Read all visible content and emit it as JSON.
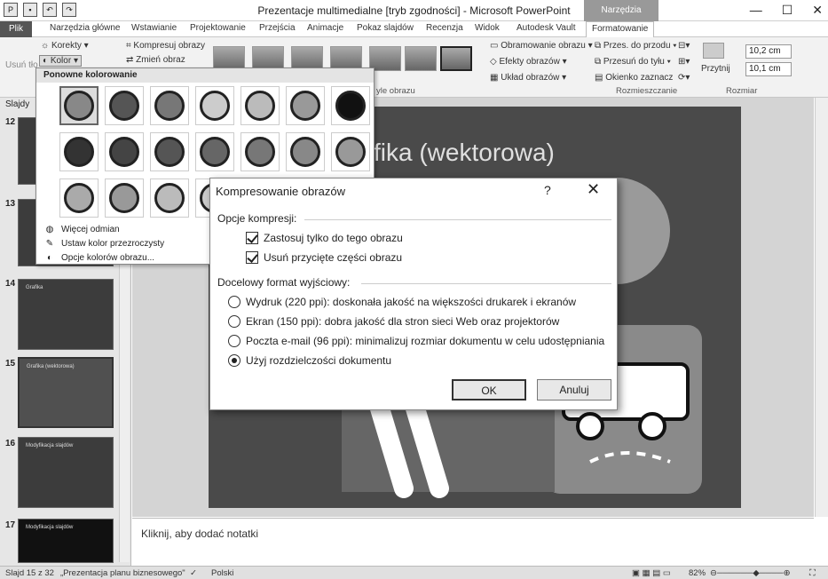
{
  "app": {
    "title": "Prezentacje multimedialne [tryb zgodności] - Microsoft PowerPoint",
    "context_tab_group": "Narzędzia obrazów",
    "window_buttons": [
      "—",
      "☐",
      "✕"
    ]
  },
  "tabs": {
    "file": "Plik",
    "items": [
      "Narzędzia główne",
      "Wstawianie",
      "Projektowanie",
      "Przejścia",
      "Animacje",
      "Pokaz slajdów",
      "Recenzja",
      "Widok",
      "Autodesk Vault"
    ],
    "active": "Formatowanie"
  },
  "ribbon": {
    "remove_bg": "Usuń tło",
    "corrections": "Korekty",
    "color": "Kolor",
    "compress": "Kompresuj obrazy",
    "change": "Zmień obraz",
    "picture_styles_label": "yle obrazu",
    "border": "Obramowanie obrazu",
    "effects": "Efekty obrazów",
    "layout": "Układ obrazów",
    "bring_forward": "Przes. do przodu",
    "send_back": "Przesuń do tyłu",
    "selection_pane": "Okienko zaznacz",
    "arrange_label": "Rozmieszczanie",
    "crop": "Przytnij",
    "height": "10,2 cm",
    "width": "10,1 cm",
    "size_label": "Rozmiar"
  },
  "recolor": {
    "header": "Ponowne kolorowanie",
    "more_variants": "Więcej odmian",
    "set_transparent": "Ustaw kolor przezroczysty",
    "color_options": "Opcje kolorów obrazu...",
    "swatch_colors": [
      [
        "#888888",
        "#555555",
        "#777777",
        "#cccccc",
        "#bbbbbb",
        "#999999",
        "#111111"
      ],
      [
        "#333333",
        "#444444",
        "#555555",
        "#666666",
        "#777777",
        "#888888",
        "#999999"
      ],
      [
        "#aaaaaa",
        "#999999",
        "#bbbbbb",
        "#cccccc",
        "#aaaaaa",
        "#bbbbbb",
        "#dddddd"
      ]
    ]
  },
  "dialog": {
    "title": "Kompresowanie obrazów",
    "help": "?",
    "close": "✕",
    "section_compress": "Opcje kompresji:",
    "apply_only": "Zastosuj tylko do tego obrazu",
    "delete_cropped": "Usuń przycięte części obrazu",
    "section_target": "Docelowy format wyjściowy:",
    "option_print": "Wydruk (220 ppi): doskonała jakość na większości drukarek i ekranów",
    "option_screen": "Ekran (150 ppi): dobra jakość dla stron sieci Web oraz projektorów",
    "option_email": "Poczta e-mail (96 ppi): minimalizuj rozmiar dokumentu w celu udostępniania",
    "option_document": "Użyj rozdzielczości dokumentu",
    "ok": "OK",
    "cancel": "Anuluj"
  },
  "slides_pane": {
    "tab_label": "Slajdy",
    "thumbs": [
      {
        "num": "12",
        "title": ""
      },
      {
        "num": "13",
        "title": ""
      },
      {
        "num": "14",
        "title": "Grafika"
      },
      {
        "num": "15",
        "title": "Grafika (wektorowa)"
      },
      {
        "num": "16",
        "title": "Modyfikacja slajdów"
      },
      {
        "num": "17",
        "title": "Modyfikacja slajdów"
      }
    ]
  },
  "slide": {
    "title_fragment": "fika (wektorowa)"
  },
  "notes": {
    "placeholder": "Kliknij, aby dodać notatki"
  },
  "status": {
    "slide": "Slajd 15 z 32",
    "theme": "„Prezentacja planu biznesowego\"",
    "language": "Polski",
    "zoom": "82%"
  }
}
